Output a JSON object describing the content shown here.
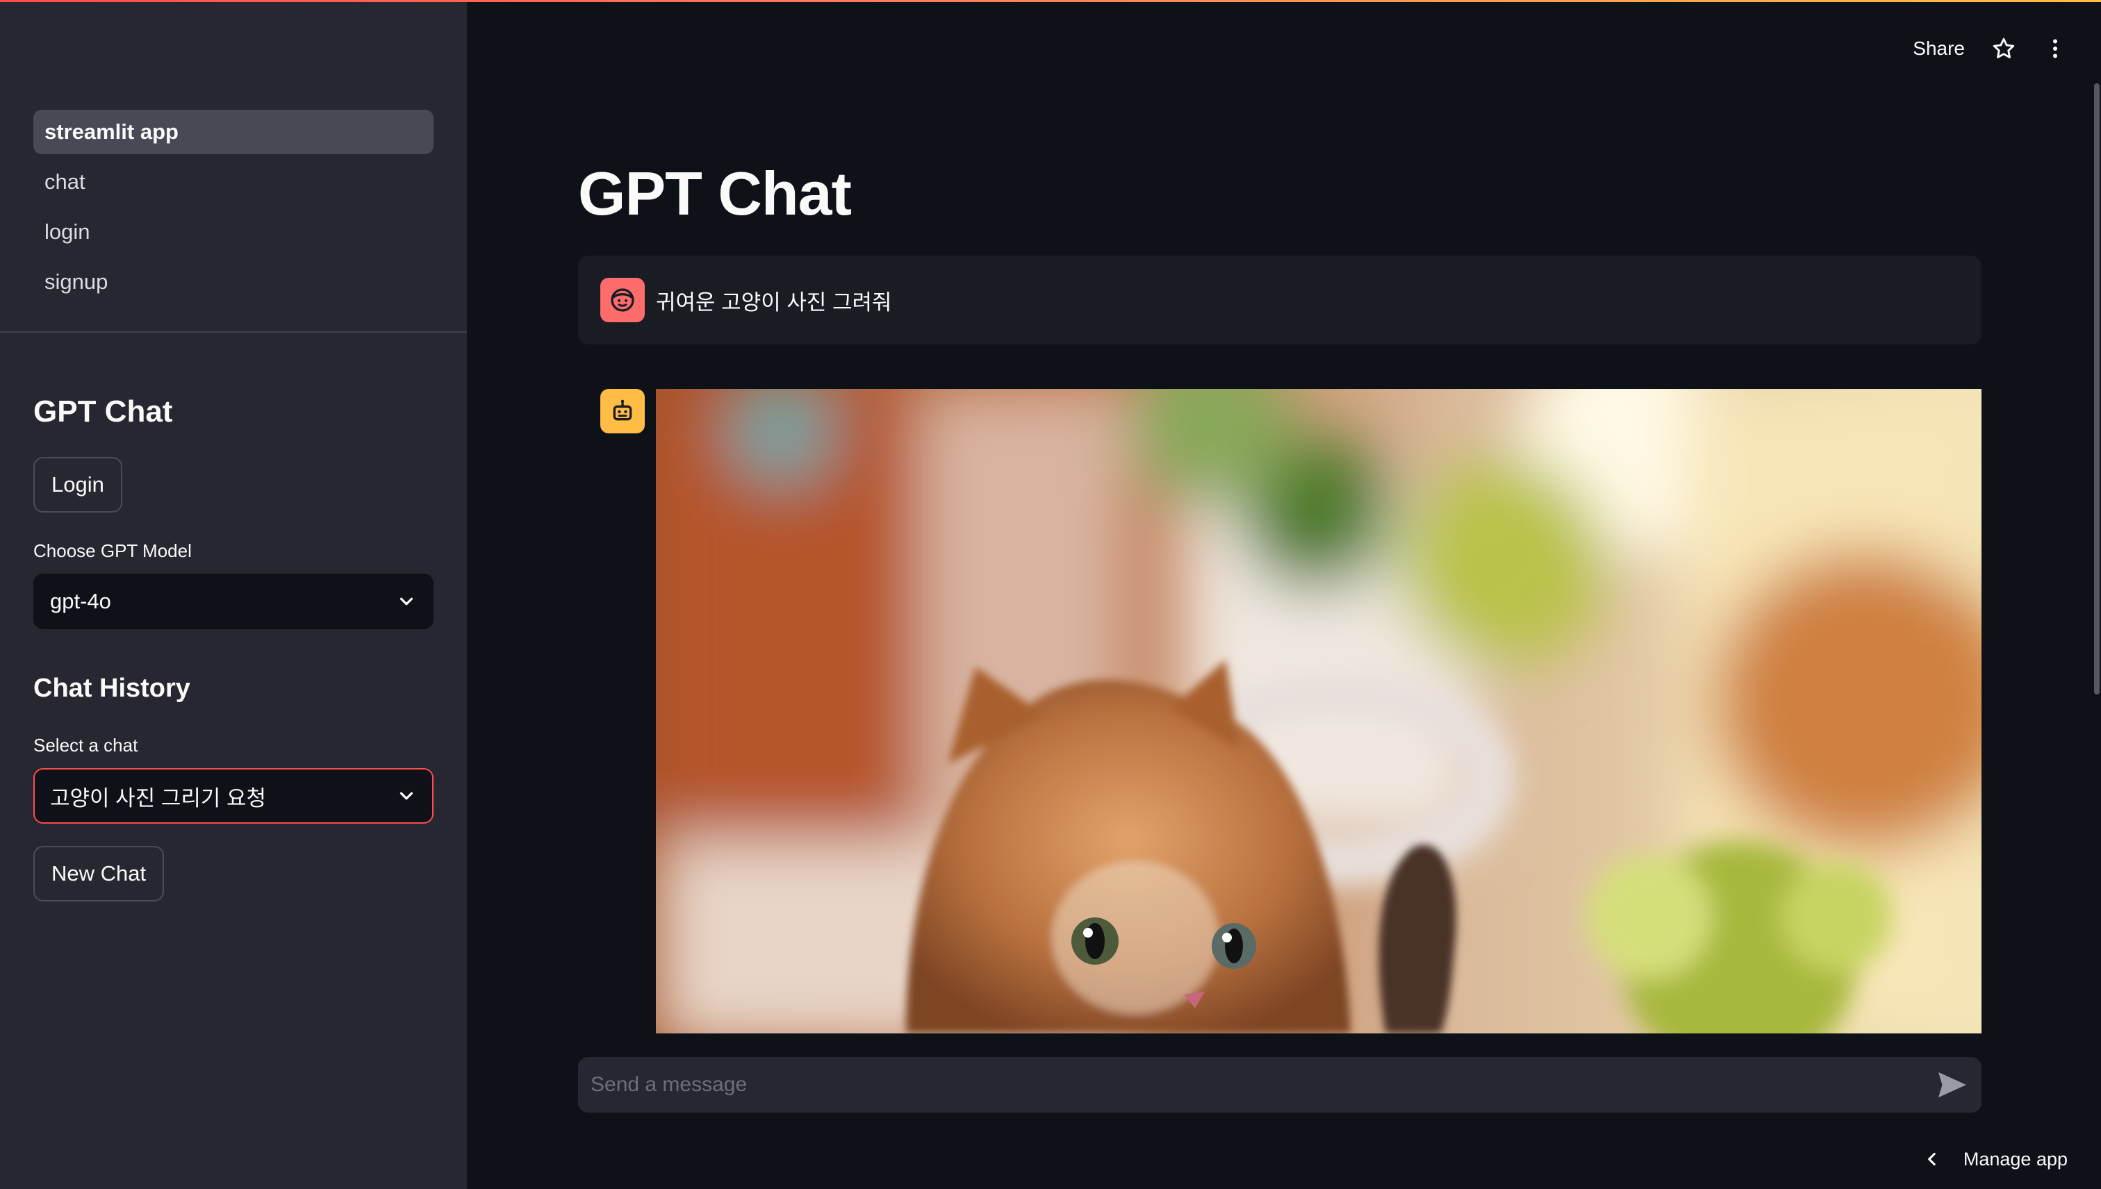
{
  "sidebar": {
    "nav": [
      {
        "label": "streamlit app",
        "active": true
      },
      {
        "label": "chat",
        "active": false
      },
      {
        "label": "login",
        "active": false
      },
      {
        "label": "signup",
        "active": false
      }
    ],
    "title": "GPT Chat",
    "login_label": "Login",
    "model_label": "Choose GPT Model",
    "model_value": "gpt-4o",
    "history_title": "Chat History",
    "select_chat_label": "Select a chat",
    "select_chat_value": "고양이 사진 그리기 요청",
    "new_chat_label": "New Chat"
  },
  "header": {
    "share_label": "Share",
    "icons": [
      "star-icon",
      "more-vertical-icon"
    ]
  },
  "main": {
    "title": "GPT Chat",
    "messages": [
      {
        "role": "user",
        "text": "귀여운 고양이 사진 그려줘"
      },
      {
        "role": "assistant",
        "content": "image"
      }
    ],
    "input_placeholder": "Send a message"
  },
  "footer": {
    "manage_label": "Manage app"
  },
  "colors": {
    "accent": "#ff4b4b",
    "user_avatar": "#ff6c6c",
    "bot_avatar": "#ffbd45",
    "background": "#0e1117",
    "sidebar": "#262730"
  }
}
